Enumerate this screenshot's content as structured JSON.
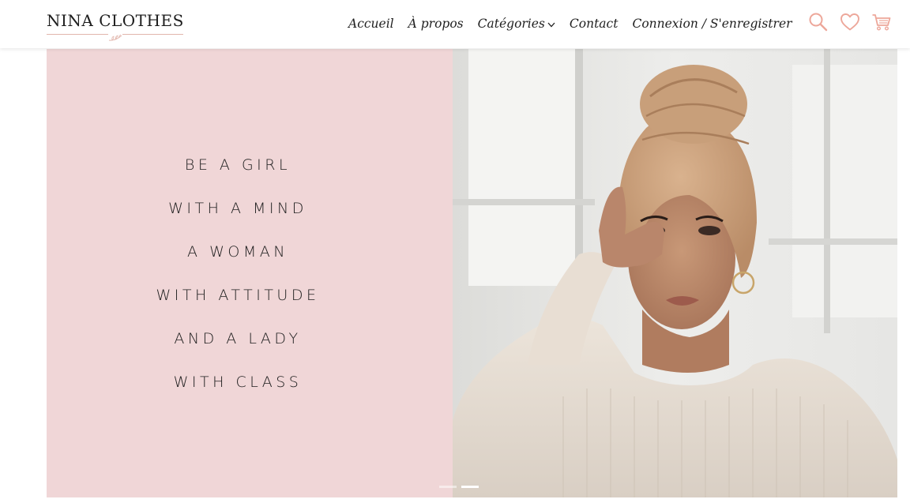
{
  "brand": {
    "name": "NINA CLOTHES"
  },
  "nav": {
    "items": [
      {
        "label": "Accueil"
      },
      {
        "label": "À propos"
      },
      {
        "label": "Catégories"
      },
      {
        "label": "Contact"
      },
      {
        "label": "Connexion / S'enregistrer"
      }
    ]
  },
  "icons": {
    "search": "search-icon",
    "wishlist": "heart-icon",
    "cart": "cart-icon",
    "accent_color": "#eda79a"
  },
  "hero": {
    "quote_lines": [
      "BE A GIRL",
      "WITH A MIND",
      "A WOMAN",
      "WITH ATTITUDE",
      "AND A LADY",
      "WITH CLASS"
    ],
    "panel_color": "#f0d6d7",
    "slide_count": 2,
    "active_slide": 2
  }
}
